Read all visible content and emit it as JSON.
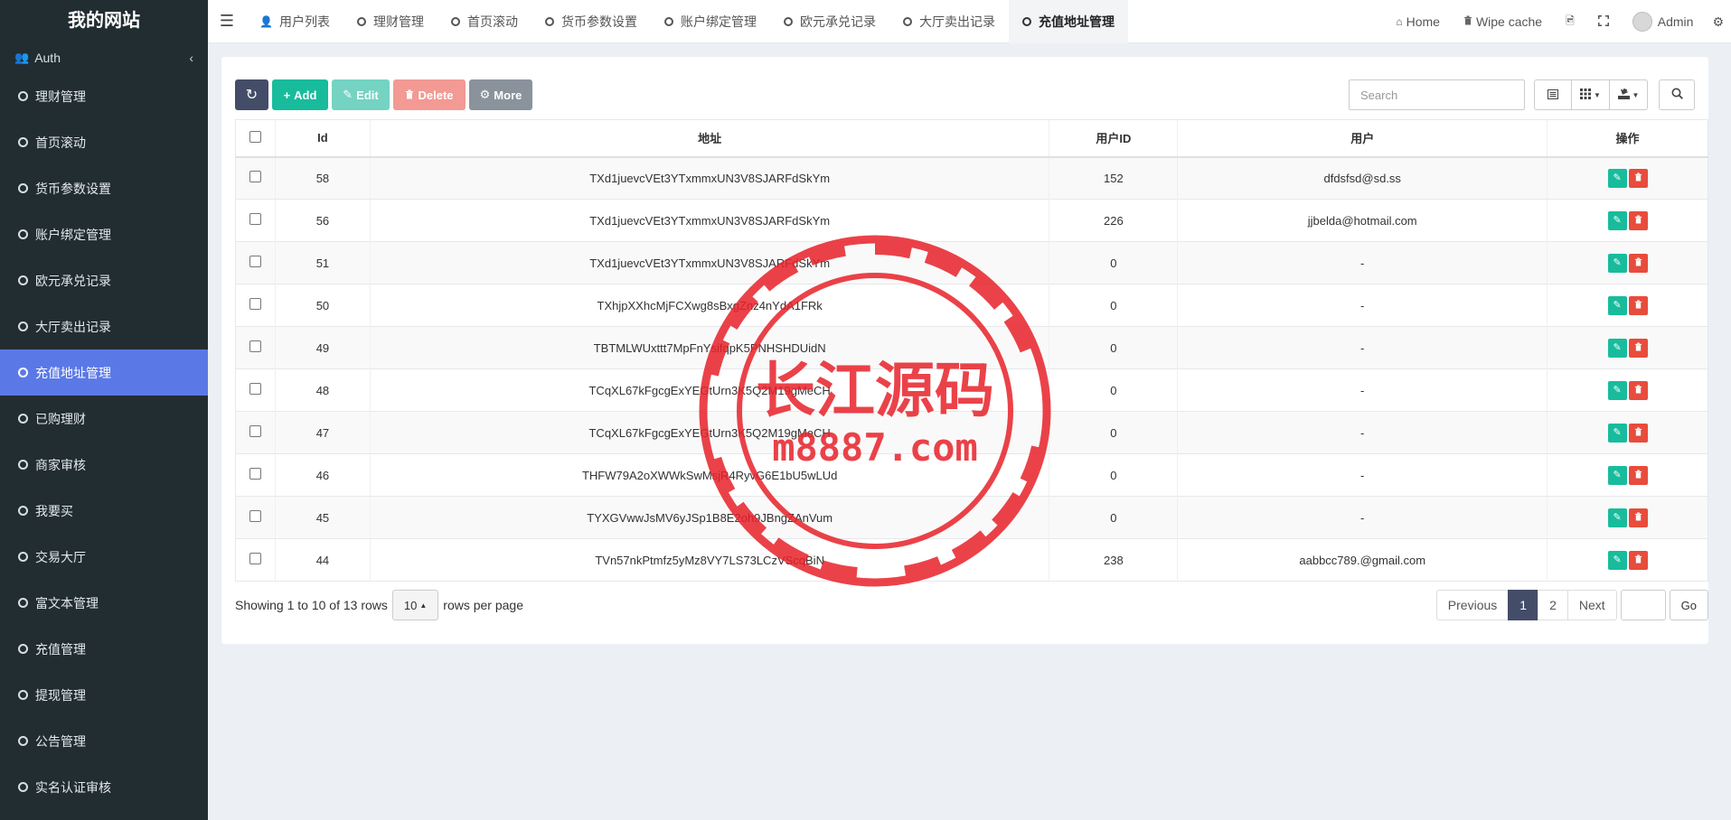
{
  "sidebar": {
    "brand": "我的网站",
    "auth_label": "Auth",
    "items": [
      {
        "label": "理财管理"
      },
      {
        "label": "首页滚动"
      },
      {
        "label": "货币参数设置"
      },
      {
        "label": "账户绑定管理"
      },
      {
        "label": "欧元承兑记录"
      },
      {
        "label": "大厅卖出记录"
      },
      {
        "label": "充值地址管理",
        "active": true
      },
      {
        "label": "已购理财"
      },
      {
        "label": "商家审核"
      },
      {
        "label": "我要买"
      },
      {
        "label": "交易大厅"
      },
      {
        "label": "富文本管理"
      },
      {
        "label": "充值管理"
      },
      {
        "label": "提现管理"
      },
      {
        "label": "公告管理"
      },
      {
        "label": "实名认证审核"
      }
    ]
  },
  "topnav": {
    "tabs": [
      {
        "label": "用户列表"
      },
      {
        "label": "理财管理"
      },
      {
        "label": "首页滚动"
      },
      {
        "label": "货币参数设置"
      },
      {
        "label": "账户绑定管理"
      },
      {
        "label": "欧元承兑记录"
      },
      {
        "label": "大厅卖出记录"
      },
      {
        "label": "充值地址管理",
        "active": true
      }
    ],
    "home_label": "Home",
    "wipe_cache_label": "Wipe cache",
    "admin_label": "Admin"
  },
  "toolbar": {
    "add_label": "Add",
    "edit_label": "Edit",
    "delete_label": "Delete",
    "more_label": "More",
    "search_placeholder": "Search"
  },
  "table": {
    "columns": [
      "Id",
      "地址",
      "用户ID",
      "用户"
    ],
    "actions_header": "操作",
    "rows": [
      {
        "id": "58",
        "address": "TXd1juevcVEt3YTxmmxUN3V8SJARFdSkYm",
        "user_id": "152",
        "user": "dfdsfsd@sd.ss"
      },
      {
        "id": "56",
        "address": "TXd1juevcVEt3YTxmmxUN3V8SJARFdSkYm",
        "user_id": "226",
        "user": "jjbelda@hotmail.com"
      },
      {
        "id": "51",
        "address": "TXd1juevcVEt3YTxmmxUN3V8SJARFdSkYm",
        "user_id": "0",
        "user": "-"
      },
      {
        "id": "50",
        "address": "TXhjpXXhcMjFCXwg8sBxgZnz4nYdA1FRk",
        "user_id": "0",
        "user": "-"
      },
      {
        "id": "49",
        "address": "TBTMLWUxttt7MpFnYsifqpK5PNHSHDUidN",
        "user_id": "0",
        "user": "-"
      },
      {
        "id": "48",
        "address": "TCqXL67kFgcgExYEGtUrn3K5Q2M19gMeCH",
        "user_id": "0",
        "user": "-"
      },
      {
        "id": "47",
        "address": "TCqXL67kFgcgExYEGtUrn3K5Q2M19gMeCH",
        "user_id": "0",
        "user": "-"
      },
      {
        "id": "46",
        "address": "THFW79A2oXWWkSwMsjR4RyvG6E1bU5wLUd",
        "user_id": "0",
        "user": "-"
      },
      {
        "id": "45",
        "address": "TYXGVwwJsMV6yJSp1B8E2oh9JBngZAnVum",
        "user_id": "0",
        "user": "-"
      },
      {
        "id": "44",
        "address": "TVn57nkPtmfz5yMz8VY7LS73LCzVScqBiN",
        "user_id": "238",
        "user": "aabbcc789.@gmail.com"
      }
    ]
  },
  "footer": {
    "showing_text": "Showing 1 to 10 of 13 rows",
    "page_size": "10",
    "rows_per_page_text": "rows per page",
    "previous_label": "Previous",
    "pages": [
      "1",
      "2"
    ],
    "current_page": "1",
    "next_label": "Next",
    "go_label": "Go"
  },
  "watermark": {
    "line1": "长江源码",
    "line2": "m8887.com",
    "color": "#e8222a"
  },
  "colors": {
    "sidebar_bg": "#222d32",
    "sidebar_active": "#5b79e6",
    "primary_dark": "#444d68",
    "success": "#18bc9c",
    "danger": "#e74c3c"
  }
}
